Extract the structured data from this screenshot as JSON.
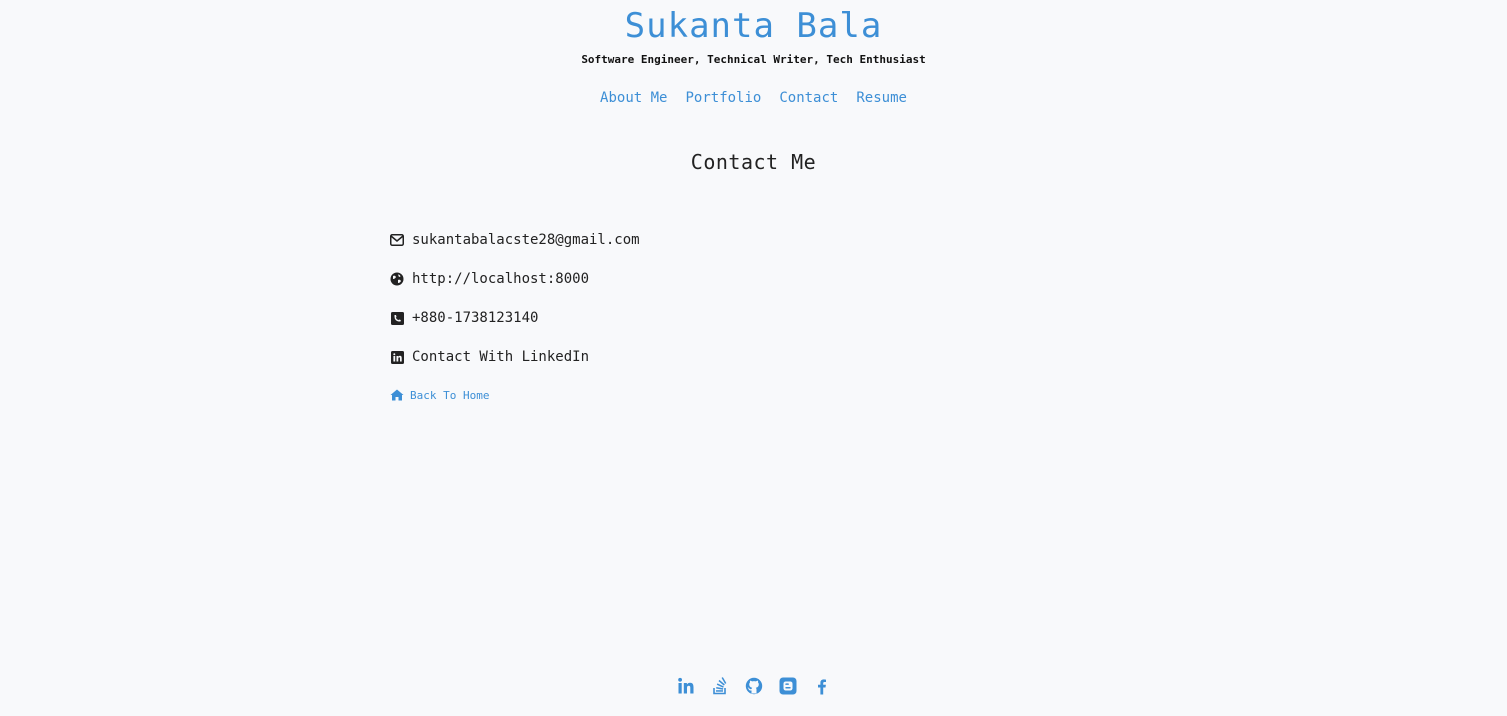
{
  "header": {
    "title": "Sukanta Bala",
    "tagline": "Software Engineer, Technical Writer, Tech Enthusiast"
  },
  "nav": {
    "items": [
      {
        "label": "About Me"
      },
      {
        "label": "Portfolio"
      },
      {
        "label": "Contact"
      },
      {
        "label": "Resume"
      }
    ]
  },
  "main": {
    "heading": "Contact Me",
    "contacts": [
      {
        "icon": "envelope-icon",
        "text": "sukantabalacste28@gmail.com"
      },
      {
        "icon": "globe-icon",
        "text": "http://localhost:8000"
      },
      {
        "icon": "phone-square-icon",
        "text": "+880-1738123140"
      },
      {
        "icon": "linkedin-square-icon",
        "text": "Contact With LinkedIn"
      }
    ],
    "back_home": {
      "icon": "home-icon",
      "label": "Back To Home"
    }
  },
  "footer": {
    "social": [
      {
        "icon": "linkedin-icon"
      },
      {
        "icon": "stackoverflow-icon"
      },
      {
        "icon": "github-icon"
      },
      {
        "icon": "blogger-icon"
      },
      {
        "icon": "facebook-icon"
      }
    ]
  },
  "colors": {
    "accent": "#3d8fd6",
    "background": "#f8f9fb",
    "text": "#222222"
  }
}
